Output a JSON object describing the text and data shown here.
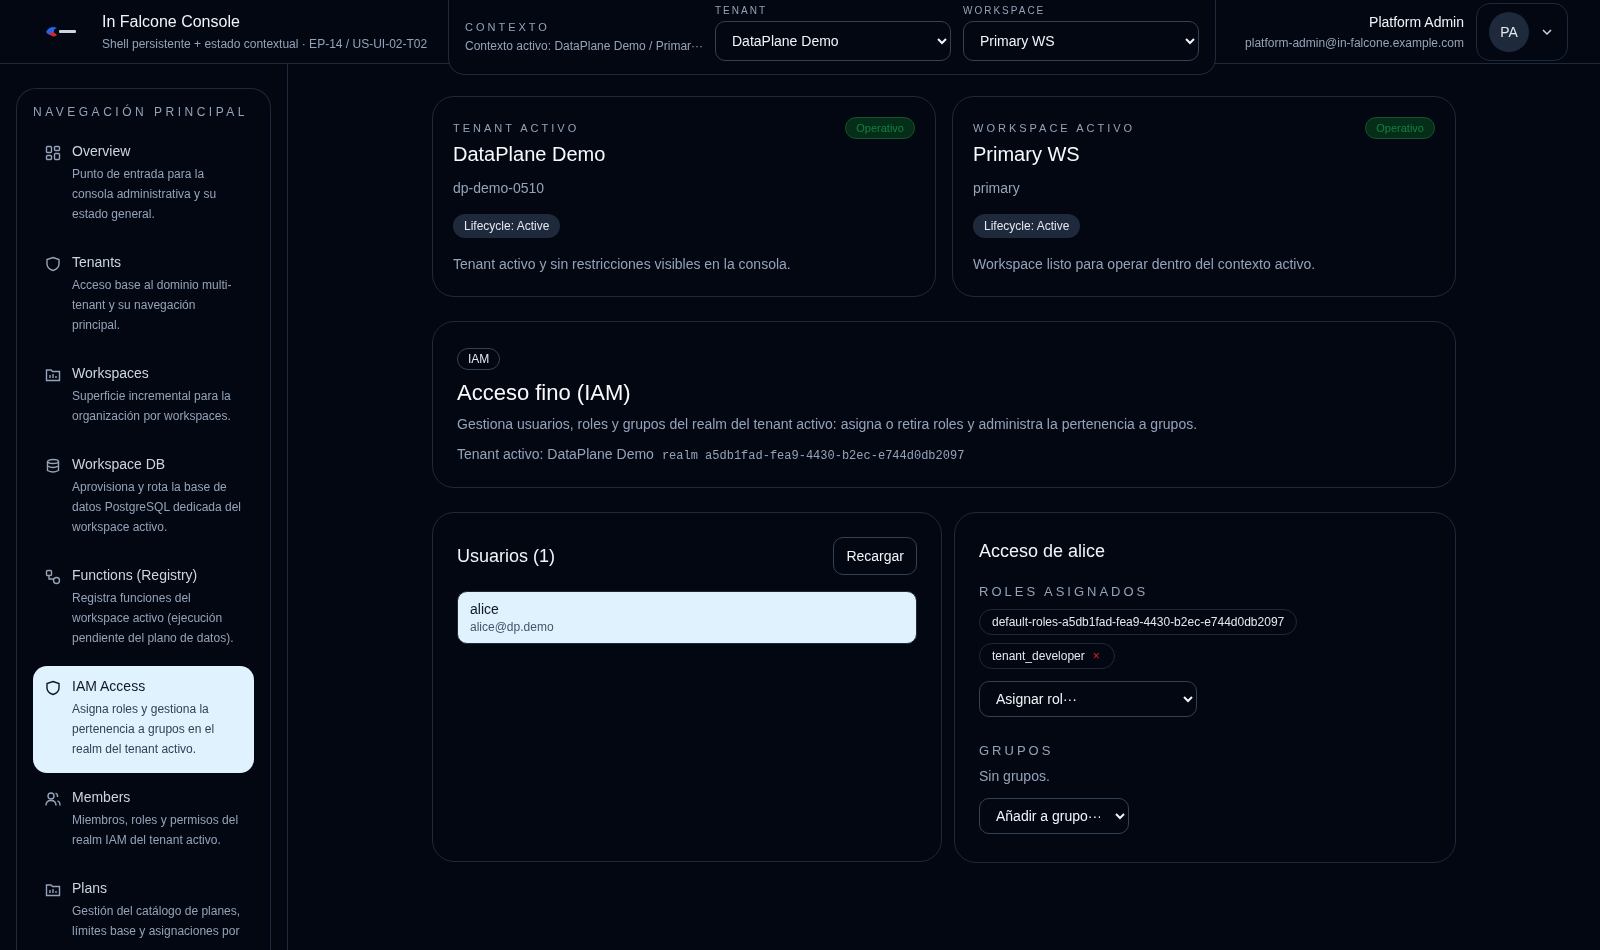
{
  "brand": {
    "title": "In Falcone Console",
    "subtitle": "Shell persistente + estado contextual · EP-14 / US-UI-02-T02"
  },
  "context": {
    "label": "CONTEXTO",
    "summary": "Contexto activo: DataPlane Demo / Primar···",
    "tenant": {
      "label": "TENANT",
      "value": "DataPlane Demo"
    },
    "workspace": {
      "label": "WORKSPACE",
      "value": "Primary WS"
    }
  },
  "user": {
    "name": "Platform Admin",
    "email": "platform-admin@in-falcone.example.com",
    "initials": "PA"
  },
  "sidebar": {
    "heading": "NAVEGACIÓN PRINCIPAL",
    "items": [
      {
        "kind": "grid",
        "label": "Overview",
        "description": "Punto de entrada para la consola administrativa y su estado general.",
        "selected": false
      },
      {
        "kind": "shield",
        "label": "Tenants",
        "description": "Acceso base al dominio multi-tenant y su navegación principal.",
        "selected": false
      },
      {
        "kind": "folder",
        "label": "Workspaces",
        "description": "Superficie incremental para la organización por workspaces.",
        "selected": false
      },
      {
        "kind": "database",
        "label": "Workspace DB",
        "description": "Aprovisiona y rota la base de datos PostgreSQL dedicada del workspace activo.",
        "selected": false
      },
      {
        "kind": "nodes",
        "label": "Functions (Registry)",
        "description": "Registra funciones del workspace activo (ejecución pendiente del plano de datos).",
        "selected": false
      },
      {
        "kind": "shield",
        "label": "IAM Access",
        "description": "Asigna roles y gestiona la pertenencia a grupos en el realm del tenant activo.",
        "selected": true
      },
      {
        "kind": "users",
        "label": "Members",
        "description": "Miembros, roles y permisos del realm IAM del tenant activo.",
        "selected": false
      },
      {
        "kind": "folder",
        "label": "Plans",
        "description": "Gestión del catálogo de planes, límites base y asignaciones por",
        "selected": false
      }
    ]
  },
  "summary_cards": [
    {
      "eyebrow": "TENANT ACTIVO",
      "status": "Operativo",
      "title": "DataPlane Demo",
      "slug": "dp-demo-0510",
      "lifecycle": "Lifecycle: Active",
      "note": "Tenant activo y sin restricciones visibles en la consola."
    },
    {
      "eyebrow": "WORKSPACE ACTIVO",
      "status": "Operativo",
      "title": "Primary WS",
      "slug": "primary",
      "lifecycle": "Lifecycle: Active",
      "note": "Workspace listo para operar dentro del contexto activo."
    }
  ],
  "iam": {
    "badge": "IAM",
    "title": "Acceso fino (IAM)",
    "description": "Gestiona usuarios, roles y grupos del realm del tenant activo: asigna o retira roles y administra la pertenencia a grupos.",
    "tenant_line": "Tenant activo: DataPlane Demo",
    "realm": "realm a5db1fad-fea9-4430-b2ec-e744d0db2097"
  },
  "users": {
    "title": "Usuarios (1)",
    "reload": "Recargar",
    "items": [
      {
        "name": "alice",
        "email": "alice@dp.demo",
        "selected": true
      }
    ]
  },
  "access": {
    "title": "Acceso de alice",
    "roles_heading": "ROLES ASIGNADOS",
    "roles": [
      {
        "name": "default-roles-a5db1fad-fea9-4430-b2ec-e744d0db2097",
        "removable": false
      },
      {
        "name": "tenant_developer",
        "removable": true
      }
    ],
    "remove_mark": "×",
    "assign_role": "Asignar rol···",
    "groups_heading": "GRUPOS",
    "groups_empty": "Sin grupos.",
    "add_group": "Añadir a grupo···"
  }
}
